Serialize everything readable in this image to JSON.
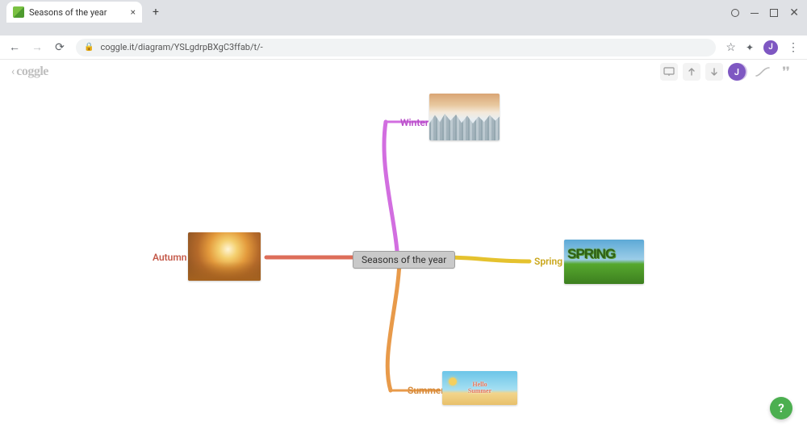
{
  "browser": {
    "tab_title": "Seasons of the year",
    "url": "coggle.it/diagram/YSLgdrpBXgC3ffab/t/-",
    "avatar_letter": "J"
  },
  "app": {
    "logo_text": "coggle",
    "avatar_letter": "J"
  },
  "mindmap": {
    "center": "Seasons of the year",
    "nodes": {
      "winter": {
        "label": "Winter",
        "color": "#d26ee0",
        "image_alt": "Snowy forest at sunset"
      },
      "autumn": {
        "label": "Autumn",
        "color": "#dd6e5a",
        "image_alt": "Golden autumn trees with fallen leaves"
      },
      "spring": {
        "label": "Spring",
        "color": "#e5c22e",
        "image_alt": "SPRING lettering made of greenery on grass"
      },
      "summer": {
        "label": "Summer",
        "color": "#e89a4a",
        "image_alt": "Hello Summer beach illustration"
      }
    }
  },
  "help": "?"
}
